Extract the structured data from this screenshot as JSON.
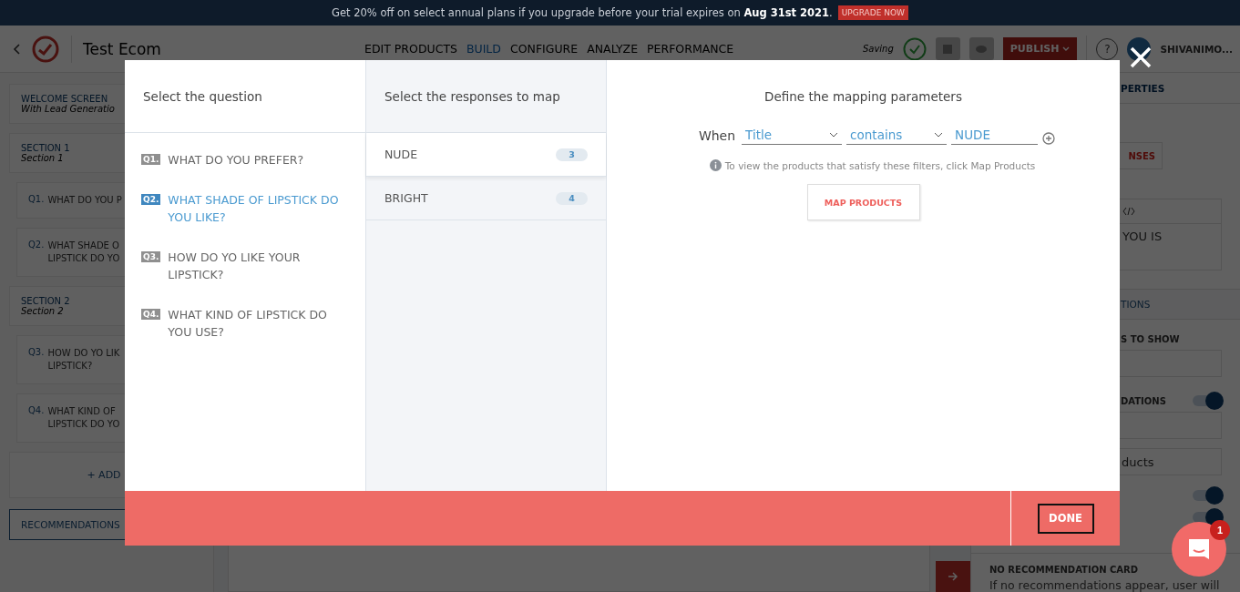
{
  "banner": {
    "text": "Get 20% off on select annual plans if you upgrade before your trial expires on **Aug 31st 2021**.",
    "button": "UPGRADE NOW"
  },
  "header": {
    "project": "Test Ecom",
    "nav": [
      {
        "label": "EDIT PRODUCTS",
        "selected": false
      },
      {
        "label": "BUILD",
        "selected": true
      },
      {
        "label": "CONFIGURE",
        "selected": false
      },
      {
        "label": "ANALYZE",
        "selected": false
      },
      {
        "label": "PERFORMANCE",
        "selected": false
      }
    ],
    "status": "Saving",
    "publish": "PUBLISH",
    "help": "?",
    "user": "SHIVANIMO..."
  },
  "sidebar": {
    "items": [
      {
        "kind": "screen",
        "title": "WELCOME SCREEN",
        "subtitle": "With Lead Generatio"
      },
      {
        "kind": "section",
        "title": "SECTION 1",
        "subtitle": "Section 1"
      },
      {
        "kind": "question",
        "number": "Q1.",
        "lines": [
          "WHAT DO YOU P"
        ]
      },
      {
        "kind": "question",
        "number": "Q2.",
        "lines": [
          "WHAT SHADE O",
          "LIPSTICK DO YO"
        ]
      },
      {
        "kind": "section",
        "title": "SECTION 2",
        "subtitle": "Section 2"
      },
      {
        "kind": "question",
        "number": "Q3.",
        "lines": [
          "HOW DO YO LIK",
          "LIPSTICK?"
        ]
      },
      {
        "kind": "question",
        "number": "Q4.",
        "lines": [
          "WHAT KIND OF",
          "LIPSTICK DO YO"
        ]
      },
      {
        "kind": "add",
        "title": "+ ADD"
      }
    ],
    "recommendations": "RECOMMENDATIONS"
  },
  "properties": {
    "items": [
      {
        "kind": "tab",
        "text": "PERTIES"
      },
      {
        "kind": "button",
        "text": "NSES"
      },
      {
        "kind": "editor",
        "text": "YOU IS"
      },
      {
        "kind": "section",
        "text": "TIONS"
      },
      {
        "kind": "label",
        "text": "S TO SHOW"
      },
      {
        "kind": "field"
      },
      {
        "kind": "label",
        "text": "DATIONS",
        "on": true
      },
      {
        "kind": "field"
      },
      {
        "kind": "field",
        "text": "ducts"
      },
      {
        "kind": "toggle",
        "on": true
      },
      {
        "kind": "toggle",
        "on": true
      }
    ],
    "card_title": "NO RECOMMENDATION CARD",
    "card_text": "If no recommendations appear, user will"
  },
  "modal": {
    "questions_title": "Select the question",
    "questions": [
      {
        "number": "Q1.",
        "text": "WHAT DO YOU PREFER?",
        "selected": false
      },
      {
        "number": "Q2.",
        "text": "WHAT SHADE OF LIPSTICK DO YOU LIKE?",
        "selected": true
      },
      {
        "number": "Q3.",
        "text": "HOW DO YO LIKE YOUR LIPSTICK?",
        "selected": false
      },
      {
        "number": "Q4.",
        "text": "WHAT KIND OF LIPSTICK DO YOU USE?",
        "selected": false
      }
    ],
    "responses_title": "Select the responses to map",
    "responses": [
      {
        "label": "NUDE",
        "count": "3",
        "selected": true
      },
      {
        "label": "BRIGHT",
        "count": "4",
        "selected": false
      }
    ],
    "mapping_title": "Define the mapping parameters",
    "when": "When",
    "field": "Title",
    "operator": "contains",
    "value": "NUDE",
    "hint": "To view the products that satisfy these filters, click Map Products",
    "map_button": "MAP PRODUCTS",
    "done": "DONE"
  },
  "chat": {
    "badge": "1"
  }
}
